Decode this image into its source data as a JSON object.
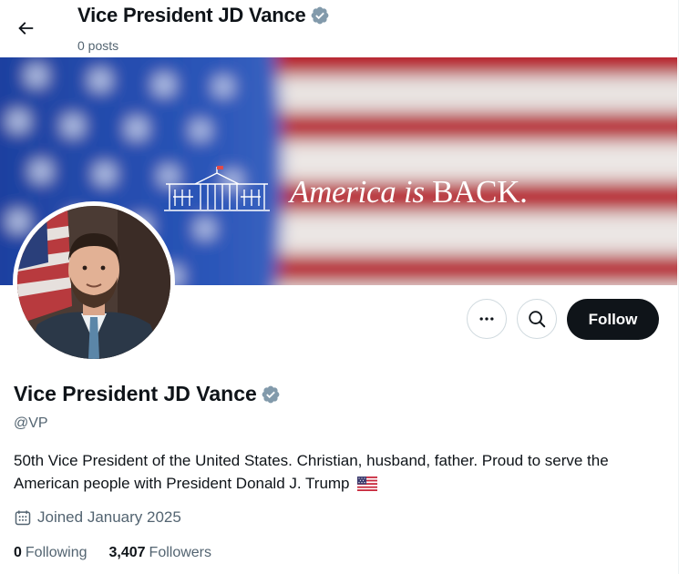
{
  "header": {
    "back_icon": "arrow-left-icon",
    "title": "Vice President JD Vance",
    "post_count": "0 posts"
  },
  "banner": {
    "slogan_italic": "America",
    "slogan_connector": " is ",
    "slogan_emphasis": "BACK.",
    "logo_icon": "white-house-icon"
  },
  "profile": {
    "name": "Vice President JD Vance",
    "verified_icon": "verified-gray-badge-icon",
    "handle": "@VP",
    "bio": "50th Vice President of the United States. Christian, husband, father. Proud to serve the American people with President Donald J. Trump",
    "bio_emoji_icon": "us-flag-icon",
    "joined": "Joined January 2025",
    "joined_icon": "calendar-icon"
  },
  "actions": {
    "more_icon": "more-dots-icon",
    "search_icon": "search-icon",
    "follow_label": "Follow"
  },
  "stats": {
    "following_count": "0",
    "following_label": "Following",
    "followers_count": "3,407",
    "followers_label": "Followers"
  },
  "colors": {
    "primary_text": "#0f1419",
    "secondary_text": "#536471",
    "follow_bg": "#0f1419",
    "verified_badge": "#829aab",
    "border": "#cfd9de"
  }
}
